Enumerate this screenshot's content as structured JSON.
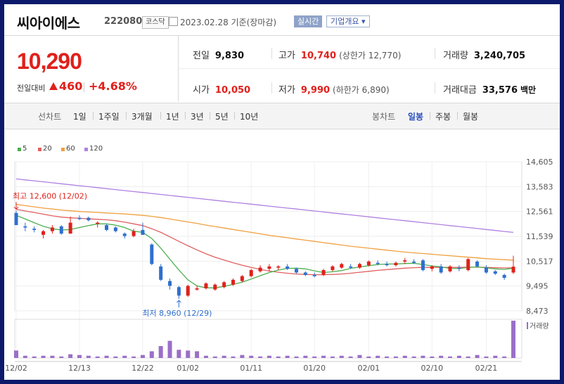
{
  "header": {
    "name": "씨아이에스",
    "code": "222080",
    "market": "코스닥",
    "date": "2023.02.28",
    "basis": "기준(장마감)",
    "realtime_label": "실시간",
    "corp_label": "기업개요"
  },
  "price": {
    "current": "10,290",
    "change_label": "전일대비",
    "change_value": "460",
    "change_pct": "+4.68%"
  },
  "stats": {
    "prev_label": "전일",
    "prev_value": "9,830",
    "high_label": "고가",
    "high_value": "10,740",
    "upper_limit": "(상한가 12,770)",
    "volume_label": "거래량",
    "volume_value": "3,240,705",
    "open_label": "시가",
    "open_value": "10,050",
    "low_label": "저가",
    "low_value": "9,990",
    "lower_limit": "(하한가 6,890)",
    "amount_label": "거래대금",
    "amount_value": "33,576",
    "amount_unit": "백만"
  },
  "tabs": {
    "line_label": "선차트",
    "periods": [
      "1일",
      "1주일",
      "3개월",
      "1년",
      "3년",
      "5년",
      "10년"
    ],
    "candle_label": "봉차트",
    "candles": [
      "일봉",
      "주봉",
      "월봉"
    ],
    "active_candle": "일봉"
  },
  "colors": {
    "up": "#e0201b",
    "down": "#2f6fce",
    "ma5": "#4caf50",
    "ma20": "#e06060",
    "ma60": "#f0a040",
    "ma120": "#b080e0",
    "volume": "#9b6fc8"
  },
  "chart_data": {
    "type": "candlestick",
    "legend": [
      "5",
      "20",
      "60",
      "120"
    ],
    "y_ticks": [
      14605,
      13583,
      12561,
      11539,
      10517,
      9495,
      8473
    ],
    "y_tick_labels": [
      "14,605",
      "13,583",
      "12,561",
      "11,539",
      "10,517",
      "9,495",
      "8,473"
    ],
    "ylim": [
      8473,
      14605
    ],
    "x_tick_labels": [
      "12/02",
      "12/13",
      "12/22",
      "01/02",
      "01/11",
      "01/20",
      "02/01",
      "02/10",
      "02/21"
    ],
    "x_tick_index": [
      0,
      7,
      14,
      19,
      26,
      33,
      39,
      46,
      52
    ],
    "high_annotation": "최고 12,600 (12/02)",
    "low_annotation": "최저 8,960 (12/29)",
    "volume_label": "거래량",
    "candles": [
      {
        "o": 12500,
        "h": 12600,
        "l": 12000,
        "c": 12000
      },
      {
        "o": 11950,
        "h": 12100,
        "l": 11750,
        "c": 11900
      },
      {
        "o": 11850,
        "h": 11950,
        "l": 11700,
        "c": 11800
      },
      {
        "o": 11600,
        "h": 11800,
        "l": 11450,
        "c": 11750
      },
      {
        "o": 11750,
        "h": 12000,
        "l": 11650,
        "c": 11900
      },
      {
        "o": 11950,
        "h": 12000,
        "l": 11600,
        "c": 11650
      },
      {
        "o": 11650,
        "h": 12350,
        "l": 11650,
        "c": 12100
      },
      {
        "o": 12300,
        "h": 12400,
        "l": 12200,
        "c": 12250
      },
      {
        "o": 12300,
        "h": 12350,
        "l": 12150,
        "c": 12200
      },
      {
        "o": 12050,
        "h": 12150,
        "l": 11900,
        "c": 12100
      },
      {
        "o": 12000,
        "h": 12050,
        "l": 11750,
        "c": 11800
      },
      {
        "o": 11900,
        "h": 11950,
        "l": 11700,
        "c": 11750
      },
      {
        "o": 11650,
        "h": 11700,
        "l": 11450,
        "c": 11550
      },
      {
        "o": 11550,
        "h": 11850,
        "l": 11500,
        "c": 11750
      },
      {
        "o": 11800,
        "h": 12100,
        "l": 11600,
        "c": 11600
      },
      {
        "o": 11200,
        "h": 11250,
        "l": 10350,
        "c": 10400
      },
      {
        "o": 10300,
        "h": 10400,
        "l": 9700,
        "c": 9750
      },
      {
        "o": 9700,
        "h": 9800,
        "l": 9350,
        "c": 9500
      },
      {
        "o": 9450,
        "h": 9500,
        "l": 8960,
        "c": 9100
      },
      {
        "o": 9100,
        "h": 9550,
        "l": 9050,
        "c": 9500
      },
      {
        "o": 9350,
        "h": 9500,
        "l": 9300,
        "c": 9400
      },
      {
        "o": 9400,
        "h": 9650,
        "l": 9350,
        "c": 9600
      },
      {
        "o": 9350,
        "h": 9600,
        "l": 9300,
        "c": 9550
      },
      {
        "o": 9450,
        "h": 9700,
        "l": 9400,
        "c": 9650
      },
      {
        "o": 9550,
        "h": 9800,
        "l": 9500,
        "c": 9750
      },
      {
        "o": 9700,
        "h": 9950,
        "l": 9650,
        "c": 9900
      },
      {
        "o": 9900,
        "h": 10200,
        "l": 9850,
        "c": 10150
      },
      {
        "o": 10100,
        "h": 10350,
        "l": 10050,
        "c": 10250
      },
      {
        "o": 10200,
        "h": 10400,
        "l": 10100,
        "c": 10300
      },
      {
        "o": 10250,
        "h": 10350,
        "l": 10150,
        "c": 10300
      },
      {
        "o": 10300,
        "h": 10400,
        "l": 10150,
        "c": 10200
      },
      {
        "o": 10200,
        "h": 10250,
        "l": 10000,
        "c": 10050
      },
      {
        "o": 10050,
        "h": 10100,
        "l": 9900,
        "c": 9950
      },
      {
        "o": 9950,
        "h": 10050,
        "l": 9850,
        "c": 9900
      },
      {
        "o": 9950,
        "h": 10200,
        "l": 9900,
        "c": 10150
      },
      {
        "o": 10150,
        "h": 10350,
        "l": 10100,
        "c": 10300
      },
      {
        "o": 10250,
        "h": 10450,
        "l": 10200,
        "c": 10400
      },
      {
        "o": 10300,
        "h": 10400,
        "l": 10200,
        "c": 10250
      },
      {
        "o": 10250,
        "h": 10450,
        "l": 10200,
        "c": 10400
      },
      {
        "o": 10350,
        "h": 10550,
        "l": 10300,
        "c": 10500
      },
      {
        "o": 10450,
        "h": 10550,
        "l": 10350,
        "c": 10400
      },
      {
        "o": 10400,
        "h": 10500,
        "l": 10300,
        "c": 10350
      },
      {
        "o": 10350,
        "h": 10500,
        "l": 10300,
        "c": 10450
      },
      {
        "o": 10500,
        "h": 10650,
        "l": 10400,
        "c": 10550
      },
      {
        "o": 10500,
        "h": 10600,
        "l": 10400,
        "c": 10450
      },
      {
        "o": 10550,
        "h": 10600,
        "l": 10100,
        "c": 10150
      },
      {
        "o": 10200,
        "h": 10350,
        "l": 10100,
        "c": 10300
      },
      {
        "o": 10300,
        "h": 10400,
        "l": 10000,
        "c": 10050
      },
      {
        "o": 10100,
        "h": 10350,
        "l": 10050,
        "c": 10300
      },
      {
        "o": 10250,
        "h": 10350,
        "l": 10100,
        "c": 10200
      },
      {
        "o": 10150,
        "h": 10650,
        "l": 10100,
        "c": 10600
      },
      {
        "o": 10500,
        "h": 10550,
        "l": 10250,
        "c": 10300
      },
      {
        "o": 10250,
        "h": 10350,
        "l": 10000,
        "c": 10050
      },
      {
        "o": 10100,
        "h": 10150,
        "l": 9950,
        "c": 10000
      },
      {
        "o": 9950,
        "h": 10000,
        "l": 9750,
        "c": 9830
      },
      {
        "o": 10050,
        "h": 10740,
        "l": 9990,
        "c": 10290
      }
    ],
    "ma5": [
      12400,
      12250,
      12100,
      11950,
      11850,
      11800,
      11820,
      11900,
      11980,
      12050,
      12050,
      12000,
      11900,
      11750,
      11700,
      11450,
      11050,
      10600,
      10150,
      9750,
      9500,
      9420,
      9420,
      9480,
      9560,
      9650,
      9780,
      9920,
      10050,
      10150,
      10220,
      10230,
      10200,
      10120,
      10050,
      10080,
      10130,
      10220,
      10280,
      10330,
      10380,
      10400,
      10400,
      10420,
      10430,
      10380,
      10320,
      10280,
      10220,
      10210,
      10260,
      10280,
      10240,
      10200,
      10180,
      10230
    ],
    "ma20": [
      12650,
      12580,
      12520,
      12450,
      12380,
      12330,
      12300,
      12280,
      12260,
      12240,
      12220,
      12180,
      12120,
      12050,
      11980,
      11850,
      11700,
      11520,
      11330,
      11150,
      10980,
      10820,
      10680,
      10560,
      10450,
      10350,
      10260,
      10180,
      10110,
      10060,
      10020,
      9990,
      9970,
      9960,
      9960,
      9970,
      9990,
      10020,
      10060,
      10100,
      10140,
      10170,
      10200,
      10230,
      10250,
      10260,
      10260,
      10260,
      10260,
      10260,
      10270,
      10270,
      10260,
      10250,
      10240,
      10240
    ],
    "ma60": [
      12850,
      12800,
      12750,
      12700,
      12660,
      12620,
      12590,
      12560,
      12540,
      12520,
      12500,
      12480,
      12460,
      12430,
      12400,
      12360,
      12310,
      12250,
      12190,
      12130,
      12070,
      12000,
      11940,
      11880,
      11820,
      11760,
      11700,
      11640,
      11580,
      11530,
      11480,
      11430,
      11380,
      11330,
      11280,
      11230,
      11180,
      11130,
      11090,
      11050,
      11010,
      10970,
      10930,
      10890,
      10860,
      10830,
      10800,
      10770,
      10740,
      10710,
      10680,
      10650,
      10620,
      10600,
      10580,
      10560
    ],
    "ma120": [
      13900,
      13860,
      13820,
      13780,
      13740,
      13700,
      13660,
      13620,
      13580,
      13540,
      13500,
      13460,
      13420,
      13380,
      13340,
      13300,
      13260,
      13220,
      13180,
      13140,
      13100,
      13060,
      13020,
      12980,
      12940,
      12900,
      12860,
      12820,
      12780,
      12740,
      12700,
      12660,
      12620,
      12580,
      12540,
      12500,
      12460,
      12420,
      12380,
      12340,
      12300,
      12260,
      12220,
      12180,
      12140,
      12100,
      12060,
      12020,
      11980,
      11940,
      11900,
      11860,
      11820,
      11780,
      11740,
      11700
    ],
    "volume": [
      10,
      3,
      2,
      3,
      3,
      2,
      5,
      4,
      3,
      2,
      3,
      2,
      3,
      2,
      4,
      9,
      16,
      23,
      11,
      10,
      9,
      3,
      2,
      3,
      2,
      4,
      3,
      2,
      3,
      2,
      3,
      2,
      3,
      2,
      3,
      2,
      3,
      2,
      4,
      2,
      3,
      2,
      2,
      3,
      2,
      3,
      2,
      3,
      2,
      3,
      2,
      4,
      2,
      3,
      2,
      50
    ]
  }
}
